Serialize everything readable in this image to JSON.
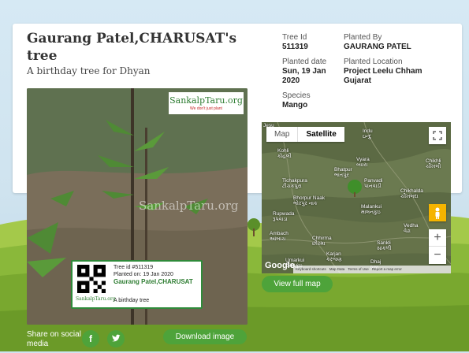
{
  "header": {
    "title": "Gaurang Patel,CHARUSAT's tree",
    "subtitle": "A birthday tree for Dhyan"
  },
  "details": {
    "tree_id_label": "Tree Id",
    "tree_id": "511319",
    "planted_by_label": "Planted By",
    "planted_by": "GAURANG PATEL",
    "planted_date_label": "Planted date",
    "planted_date": "Sun, 19 Jan 2020",
    "planted_location_label": "Planted Location",
    "planted_location": "Project Leelu Chham Gujarat",
    "species_label": "Species",
    "species": "Mango"
  },
  "photo": {
    "logo_text": "SankalpTaru.org",
    "logo_sub": "We don't just plant",
    "watermark": "SankalpTaru.org",
    "tag_tree_id": "Tree id #511319",
    "tag_planted_on": "Planted on: 19 Jan 2020",
    "tag_name": "Gaurang Patel,CHARUSAT",
    "tag_message": "A birthday tree",
    "tag_logo": "SankalpTaru.org"
  },
  "map": {
    "map_label": "Map",
    "satellite_label": "Satellite",
    "zoom_in": "+",
    "zoom_out": "−",
    "google": "Google",
    "attrib_shortcuts": "Keyboard shortcuts",
    "attrib_data": "Map Data",
    "attrib_terms": "Terms of Use",
    "attrib_report": "Report a map error",
    "places": {
      "kohli": "Kohli\nકોહલી",
      "vyara": "Vyara\nવ્યારા",
      "chikhli": "Chikhli\nચીખલી",
      "bhatpur": "Bhatpur\nભાતપુર",
      "tichakpura": "Tichakpura\nટીચકપુરા",
      "panvadi": "Panvadi\nપાનવાડી",
      "bhorpur": "Bhorpur Naak\nભોરપુર નાક",
      "chikhalda": "Chikhalda\nચીખલદા",
      "rupwada": "Rupwada\nરૂપવાડા",
      "malankui": "Malankui\nમાલનકુઇ",
      "vedha": "Vedha\nવેઢા",
      "ambach": "Ambach\nઆંબાચ",
      "chhirma": "Chhirma\nછીરમા",
      "sankli": "Sankli\nસાંકળી",
      "karjan": "Karjan\nકરજણ",
      "umarkui": "Umarkui\nઉમરકુઇ",
      "dhaj": "Dhaj\nધજ",
      "indu": "Indu\nઇન્દુ",
      "jesu": "Jesu"
    }
  },
  "actions": {
    "view_full_map": "View full map",
    "share_label": "Share on social media",
    "facebook_glyph": "f",
    "download_image": "Download image"
  }
}
